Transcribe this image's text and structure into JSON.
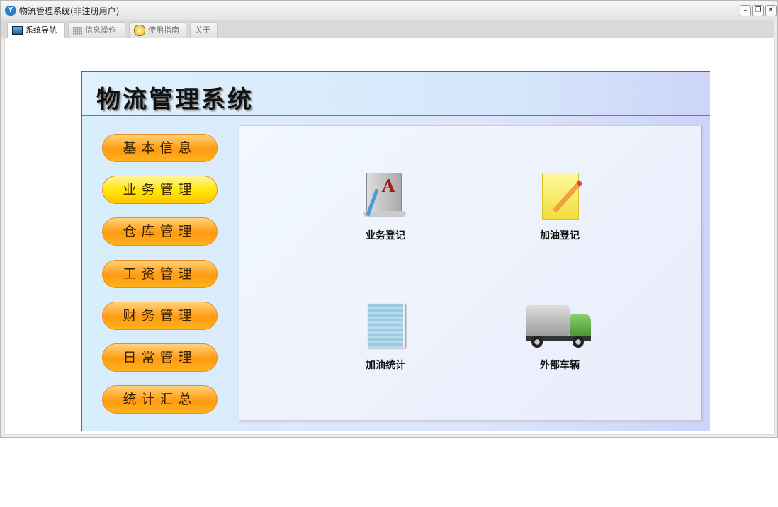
{
  "window": {
    "title": "物流管理系统(非注册用户)",
    "controls": [
      "minimize",
      "restore",
      "close"
    ]
  },
  "tabs": [
    {
      "label": "系统导航",
      "icon": "monitor-icon"
    },
    {
      "label": "信息操作",
      "icon": "grid-icon"
    },
    {
      "label": "使用指南",
      "icon": "help-icon"
    },
    {
      "label": "关于"
    }
  ],
  "header": {
    "title": "物流管理系统"
  },
  "menu": [
    {
      "label": "基本信息"
    },
    {
      "label": "业务管理"
    },
    {
      "label": "仓库管理"
    },
    {
      "label": "工资管理"
    },
    {
      "label": "财务管理"
    },
    {
      "label": "日常管理"
    },
    {
      "label": "统计汇总"
    }
  ],
  "functions": [
    {
      "label": "业务登记",
      "icon": "document-edit-icon"
    },
    {
      "label": "加油登记",
      "icon": "note-pencil-icon"
    },
    {
      "label": "加油统计",
      "icon": "notebook-icon"
    },
    {
      "label": "外部车辆",
      "icon": "truck-icon"
    }
  ]
}
